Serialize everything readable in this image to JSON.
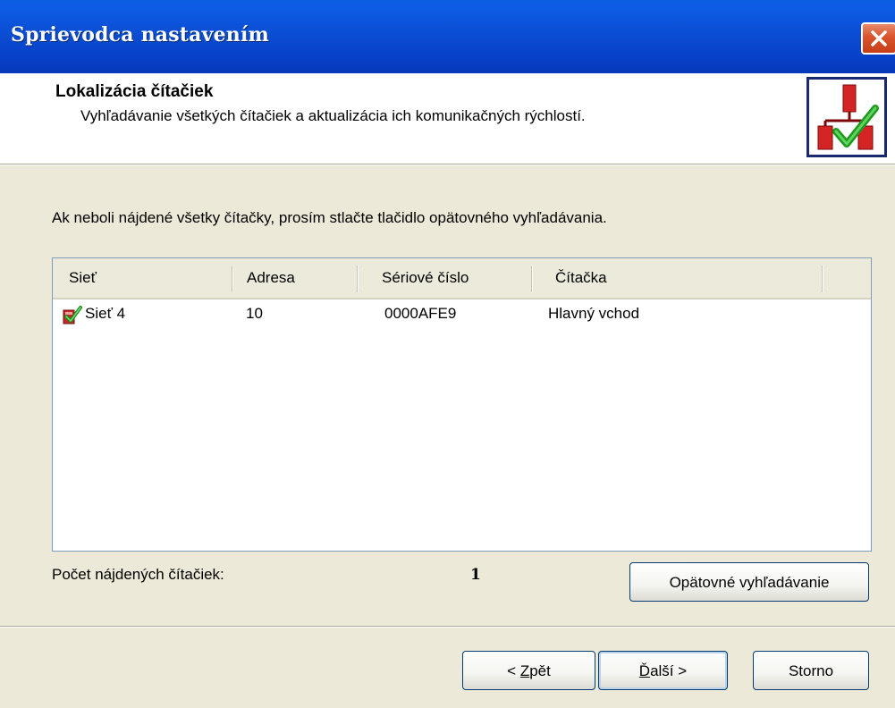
{
  "window": {
    "title": "Sprievodca nastavením"
  },
  "header": {
    "title": "Lokalizácia čítačiek",
    "subtitle": "Vyhľadávanie všetkých čítačiek a aktualizácia ich komunikačných rýchlostí.",
    "icon": "readers-check-icon"
  },
  "instruction": "Ak neboli nájdené všetky čítačky, prosím stlačte tlačidlo opätovného vyhľadávania.",
  "list": {
    "columns": [
      "Sieť",
      "Adresa",
      "Sériové číslo",
      "Čítačka"
    ],
    "rows": [
      {
        "icon": "checked-reader-icon",
        "network": "Sieť 4",
        "address": "10",
        "serial": "0000AFE9",
        "reader": "Hlavný vchod"
      }
    ]
  },
  "count": {
    "label": "Počet nájdených čítačiek:",
    "value": "1"
  },
  "buttons": {
    "research": "Opätovné vyhľadávanie",
    "back_prefix": "< ",
    "back_key": "Z",
    "back_rest": "pět",
    "next_key": "Ď",
    "next_rest": "alší >",
    "cancel": "Storno"
  },
  "colors": {
    "titlebar": "#0a4ed4",
    "dialog_bg": "#ece9d8",
    "close_button": "#d9532b"
  }
}
